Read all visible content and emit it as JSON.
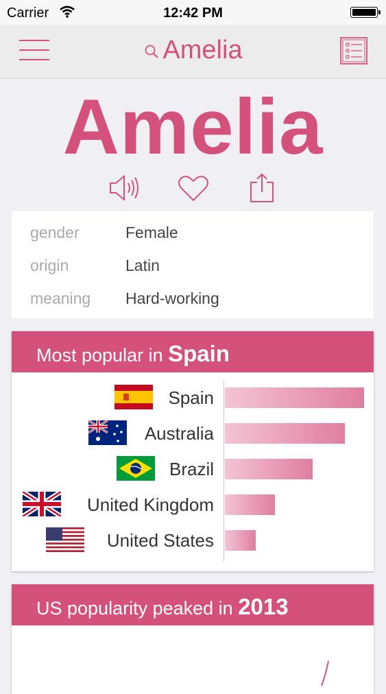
{
  "status_bar": {
    "carrier": "Carrier",
    "time": "12:42 PM"
  },
  "nav": {
    "title": "Amelia"
  },
  "hero": {
    "name": "Amelia"
  },
  "info": [
    {
      "label": "gender",
      "value": "Female"
    },
    {
      "label": "origin",
      "value": "Latin"
    },
    {
      "label": "meaning",
      "value": "Hard-working"
    }
  ],
  "popular": {
    "title_prefix": "Most popular in",
    "title_country": "Spain",
    "countries": [
      {
        "name": "Spain",
        "flag": "spain-flag",
        "bar_fraction": 1.0
      },
      {
        "name": "Australia",
        "flag": "australia-flag",
        "bar_fraction": 0.86
      },
      {
        "name": "Brazil",
        "flag": "brazil-flag",
        "bar_fraction": 0.63
      },
      {
        "name": "United Kingdom",
        "flag": "uk-flag",
        "bar_fraction": 0.36
      },
      {
        "name": "United States",
        "flag": "us-flag",
        "bar_fraction": 0.22
      }
    ]
  },
  "us_peak": {
    "title_prefix": "US popularity peaked in",
    "year": "2013"
  },
  "colors": {
    "accent": "#d4517b",
    "background": "#efeff4"
  }
}
